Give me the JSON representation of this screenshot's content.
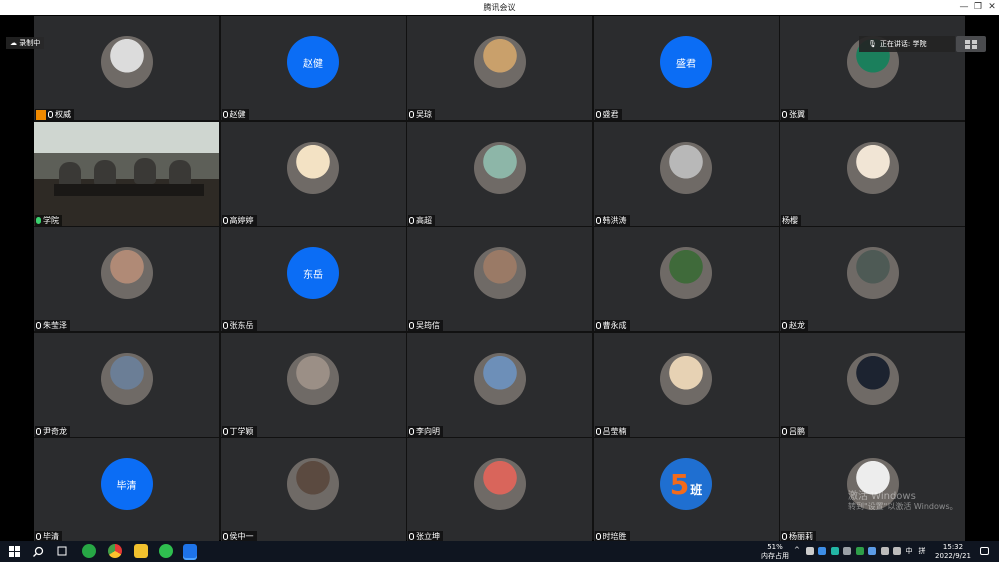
{
  "window": {
    "title": "腾讯会议",
    "minimize_glyph": "—",
    "maximize_glyph": "❐",
    "close_glyph": "✕"
  },
  "overlay": {
    "recording_label": "录制中",
    "speaking_label": "正在讲话: 学院"
  },
  "participants": [
    {
      "name": "权威",
      "avatar": "photo",
      "host": true,
      "color": "#dcdcdc"
    },
    {
      "name": "赵健",
      "avatar": "text",
      "avatar_text": "赵健"
    },
    {
      "name": "吴琼",
      "avatar": "photo",
      "color": "#c9a06b"
    },
    {
      "name": "盛君",
      "avatar": "text",
      "avatar_text": "盛君"
    },
    {
      "name": "张翼",
      "avatar": "photo",
      "color": "#1b7f5c"
    },
    {
      "name": "学院",
      "avatar": "video",
      "active": true
    },
    {
      "name": "高婷婷",
      "avatar": "photo",
      "color": "#f3e2c4"
    },
    {
      "name": "高超",
      "avatar": "photo",
      "color": "#8db6a8"
    },
    {
      "name": "韩洪涛",
      "avatar": "photo",
      "color": "#b8b8b8"
    },
    {
      "name": "杨樱",
      "avatar": "photo",
      "color": "#f1e5d5",
      "no_mic": true
    },
    {
      "name": "朱莹泽",
      "avatar": "photo",
      "color": "#b08a76"
    },
    {
      "name": "张东岳",
      "avatar": "text",
      "avatar_text": "东岳"
    },
    {
      "name": "吴筠信",
      "avatar": "photo",
      "color": "#9a7a66"
    },
    {
      "name": "曹永成",
      "avatar": "photo",
      "color": "#3f6a3a"
    },
    {
      "name": "赵龙",
      "avatar": "photo",
      "color": "#4e5a55"
    },
    {
      "name": "尹奇龙",
      "avatar": "photo",
      "color": "#6b7e96"
    },
    {
      "name": "丁学颖",
      "avatar": "photo",
      "color": "#9b8f86"
    },
    {
      "name": "李向明",
      "avatar": "photo",
      "color": "#6d8fb8"
    },
    {
      "name": "吕莹楠",
      "avatar": "photo",
      "color": "#e7d2b4"
    },
    {
      "name": "吕鹏",
      "avatar": "photo",
      "color": "#1c2330"
    },
    {
      "name": "毕清",
      "avatar": "text",
      "avatar_text": "毕清"
    },
    {
      "name": "侯中一",
      "avatar": "photo",
      "color": "#5b4a40"
    },
    {
      "name": "张立坤",
      "avatar": "photo",
      "color": "#d9655b"
    },
    {
      "name": "时培胜",
      "avatar": "badge",
      "avatar_text": "5",
      "avatar_text2": "班"
    },
    {
      "name": "杨丽莉",
      "avatar": "photo",
      "color": "#ededed"
    }
  ],
  "watermark": {
    "line1": "激活 Windows",
    "line2": "转到\"设置\"以激活 Windows。"
  },
  "taskbar": {
    "memory_percent": "51%",
    "memory_label": "内存占用",
    "time": "15:32",
    "date": "2022/9/21",
    "ime": "中",
    "ime2": "拼"
  },
  "colors": {
    "accent_blue": "#0b6df5",
    "active_green": "#3bb54a",
    "tile_bg": "#2b2c2e"
  }
}
